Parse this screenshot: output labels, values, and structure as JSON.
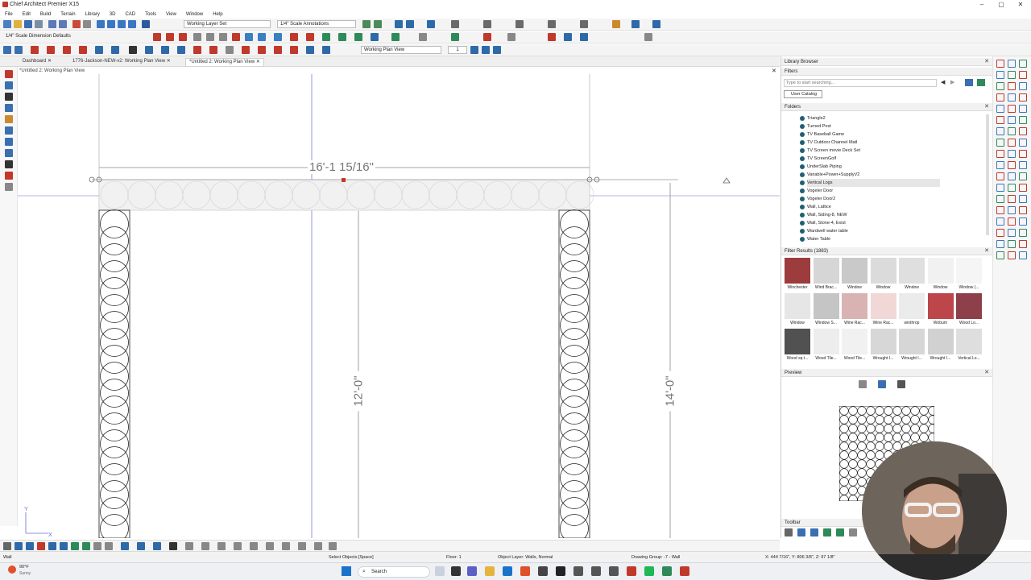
{
  "window": {
    "title": "Chief Architect Premier X15",
    "controls": [
      "–",
      "▢",
      "✕"
    ]
  },
  "menu": [
    "File",
    "Edit",
    "Build",
    "Terrain",
    "Library",
    "3D",
    "CAD",
    "Tools",
    "View",
    "Window",
    "Help"
  ],
  "toolbar": {
    "layer_set": "Working Layer Set",
    "annotation_set": "1/4\" Scale Annotations",
    "dimension_defaults": "1/4\" Scale Dimension Defaults",
    "plan_view": "Working Plan View",
    "scale_value": "1"
  },
  "tabs": [
    {
      "label": "Dashboard"
    },
    {
      "label": "1776-Jackson-NEW-v2: Working Plan View"
    },
    {
      "label": "*Untitled 2: Working Plan View"
    }
  ],
  "view_label": "*Untitled 2: Working Plan View",
  "drawing": {
    "dim_top": "16'-1 15/16\"",
    "dim_mid": "12'-0\"",
    "dim_right": "14'-0\""
  },
  "library": {
    "title": "Library Browser",
    "filters_label": "Filters",
    "search_placeholder": "Type to start searching...",
    "catalog": "User Catalog",
    "folders_label": "Folders",
    "folders": [
      "Triangle2",
      "Turned Post",
      "TV Baseball Game",
      "TV Outdoor Channel Matl",
      "TV Screen movie Deck Set",
      "TV ScreenGolf",
      "UnderSlab Piping",
      "Variable+Power+SupplyV2",
      "Vertical Logs",
      "Vogeler Door",
      "Vogeler Door2",
      "Wall, Lattice",
      "Wall, Siding-8, NEW",
      "Wall, Stone-4, Exist",
      "Wardwell water table",
      "Water Table"
    ],
    "selected_folder": "Vertical Logs",
    "filter_results": "Filter Results (1883)",
    "results": [
      "Winchester",
      "Wind Brac...",
      "Window",
      "Window",
      "Window",
      "Window",
      "Window (...",
      "Window",
      "Window S...",
      "Wine Rac...",
      "Wine Rac...",
      "winthrop",
      "Woburn",
      "Wood Lo...",
      "Wood sq t...",
      "Wood Tile...",
      "Wood Tile...",
      "Wrought I...",
      "Wrought I...",
      "Wrought I...",
      "Vertical Lo..."
    ],
    "preview_label": "Preview",
    "toolbar_label": "Toolbar"
  },
  "status": {
    "left": "Wall",
    "hint": "Select Objects [Space]",
    "floor": "Floor: 1",
    "layer": "Object Layer: Walls, Normal",
    "group": "Drawing Group: -7 - Wall",
    "coords": "X: 444 7/16\", Y: 806 3/8\", Z: 97 1/8\""
  },
  "taskbar": {
    "search": "Search",
    "weather_temp": "90°F",
    "weather_desc": "Sunny"
  },
  "colors": {
    "accent": "#1a73c8",
    "log_stroke": "#222222",
    "folder_dot": "#1f5f74",
    "guide_line": "#7a7ae0"
  }
}
